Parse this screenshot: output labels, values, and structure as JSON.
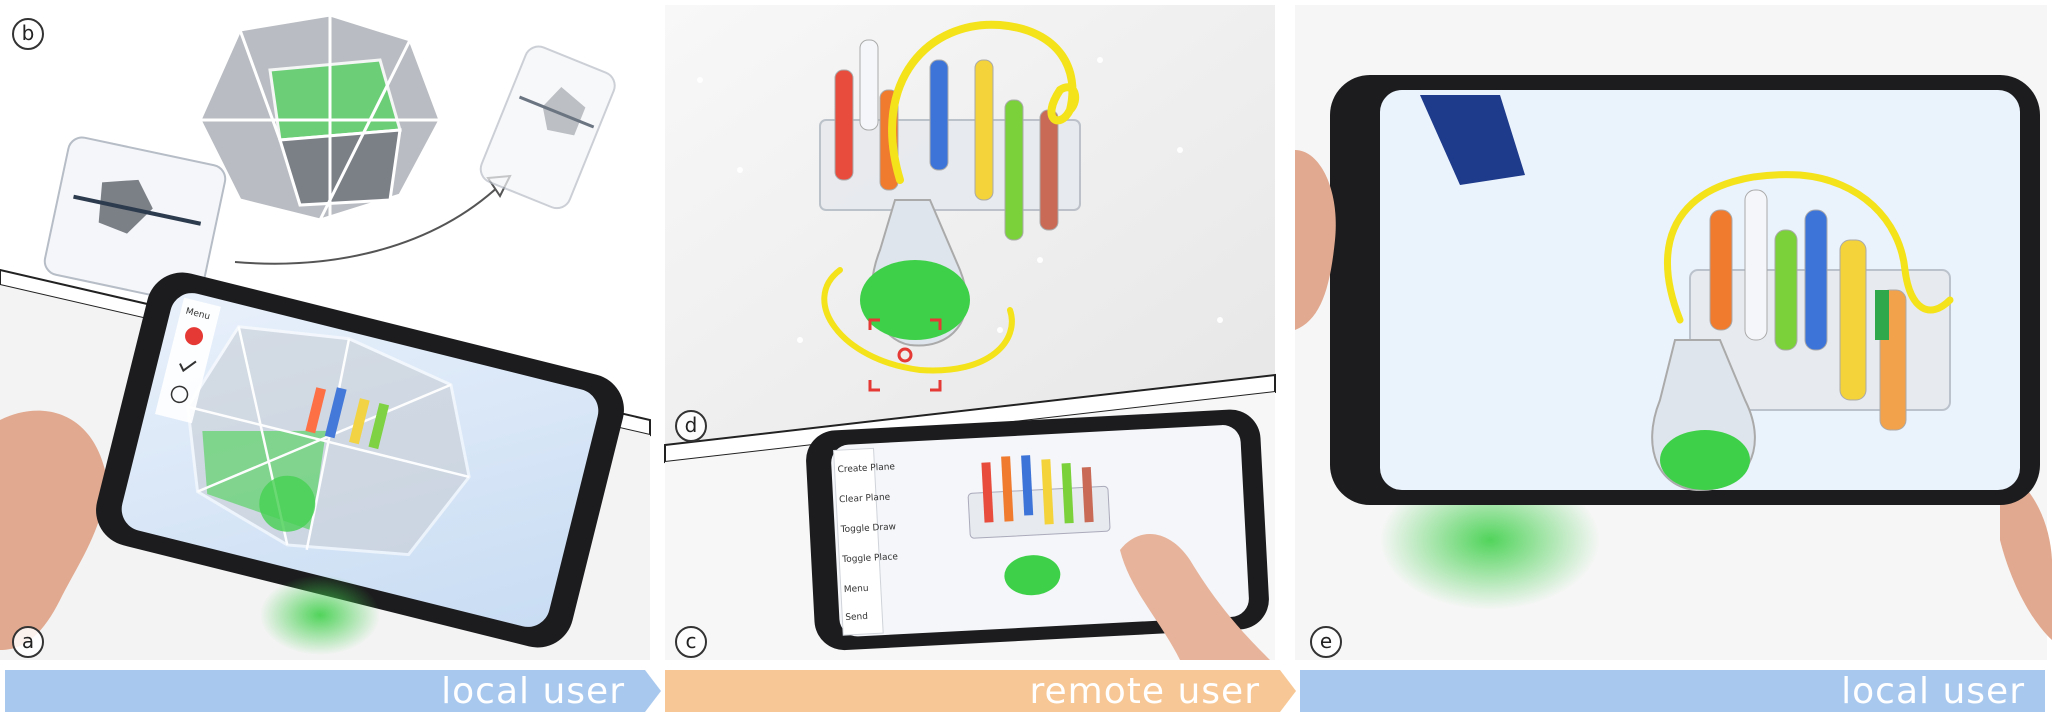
{
  "panels": {
    "a": {
      "letter": "a"
    },
    "b": {
      "letter": "b"
    },
    "c": {
      "letter": "c"
    },
    "d": {
      "letter": "d"
    },
    "e": {
      "letter": "e"
    }
  },
  "phone_a_menu": {
    "title": "Menu"
  },
  "phone_c_menu": {
    "items": [
      "Create Plane",
      "Clear Plane",
      "Toggle Draw",
      "Toggle Place",
      "Menu",
      "Send"
    ]
  },
  "banners": {
    "left": "local user",
    "middle": "remote user",
    "right": "local user"
  },
  "colors": {
    "local_user_banner": "#a9c8ee",
    "remote_user_banner": "#f7c895",
    "sketch_yellow": "#f4e21a",
    "liquid_green": "#3fd04a",
    "target_red": "#e53935"
  }
}
